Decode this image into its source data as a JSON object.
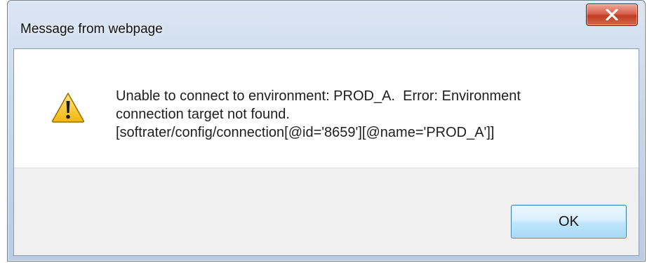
{
  "dialog": {
    "title": "Message from webpage",
    "close_icon": "close-x-icon",
    "warning_icon": "warning-triangle-icon",
    "message_lines": [
      "Unable to connect to environment: PROD_A.  Error: Environment",
      "connection target not found.",
      "[softrater/config/connection[@id='8659'][@name='PROD_A']]"
    ],
    "ok_label": "OK"
  },
  "colors": {
    "close_button": "#c13c22",
    "ok_button_border": "#3c7fb1",
    "footer": "#f0f0f0",
    "warning_yellow": "#f7c51c"
  }
}
